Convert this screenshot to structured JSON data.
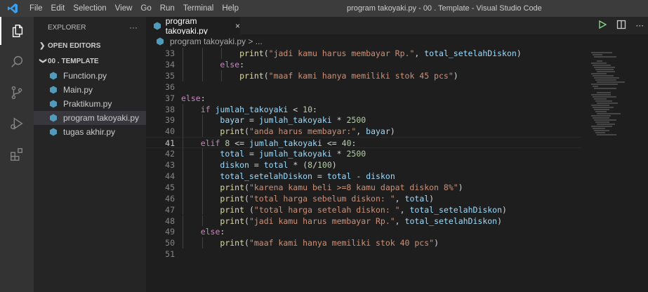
{
  "titlebar": {
    "menus": [
      "File",
      "Edit",
      "Selection",
      "View",
      "Go",
      "Run",
      "Terminal",
      "Help"
    ],
    "window_title": "program takoyaki.py - 00 . Template - Visual Studio Code"
  },
  "sidebar": {
    "header": "EXPLORER",
    "more": "···",
    "open_editors": "OPEN EDITORS",
    "folder": "00 . TEMPLATE",
    "files": [
      "Function.py",
      "Main.py",
      "Praktikum.py",
      "program takoyaki.py",
      "tugas akhir.py"
    ]
  },
  "tab": {
    "label": "program takoyaki.py",
    "close": "×"
  },
  "breadcrumb": "program takoyaki.py > ...",
  "colors": {
    "python_icon": "#519aba",
    "keyword": "#c586c0",
    "function": "#dcdcaa",
    "string": "#ce9178",
    "number": "#b5cea8",
    "variable": "#9cdcfe"
  },
  "editor": {
    "lines": [
      {
        "n": "33",
        "code": "            print(\"jadi kamu harus membayar Rp.\", total_setelahDiskon)"
      },
      {
        "n": "34",
        "code": "        else:"
      },
      {
        "n": "35",
        "code": "            print(\"maaf kami hanya memiliki stok 45 pcs\")"
      },
      {
        "n": "36",
        "code": ""
      },
      {
        "n": "37",
        "code": "else:"
      },
      {
        "n": "38",
        "code": "    if jumlah_takoyaki < 10:"
      },
      {
        "n": "39",
        "code": "        bayar = jumlah_takoyaki * 2500"
      },
      {
        "n": "40",
        "code": "        print(\"anda harus membayar:\", bayar)"
      },
      {
        "n": "41",
        "code": "    elif 8 <= jumlah_takoyaki <= 40:"
      },
      {
        "n": "42",
        "code": "        total = jumlah_takoyaki * 2500"
      },
      {
        "n": "43",
        "code": "        diskon = total * (8/100)"
      },
      {
        "n": "44",
        "code": "        total_setelahDiskon = total - diskon"
      },
      {
        "n": "45",
        "code": "        print(\"karena kamu beli >=8 kamu dapat diskon 8%\")"
      },
      {
        "n": "46",
        "code": "        print(\"total harga sebelum diskon: \", total)"
      },
      {
        "n": "47",
        "code": "        print (\"total harga setelah diskon: \", total_setelahDiskon)"
      },
      {
        "n": "48",
        "code": "        print(\"jadi kamu harus membayar Rp.\", total_setelahDiskon)"
      },
      {
        "n": "49",
        "code": "    else:"
      },
      {
        "n": "50",
        "code": "        print(\"maaf kami hanya memiliki stok 40 pcs\")"
      },
      {
        "n": "51",
        "code": ""
      }
    ],
    "current_line": "41"
  }
}
